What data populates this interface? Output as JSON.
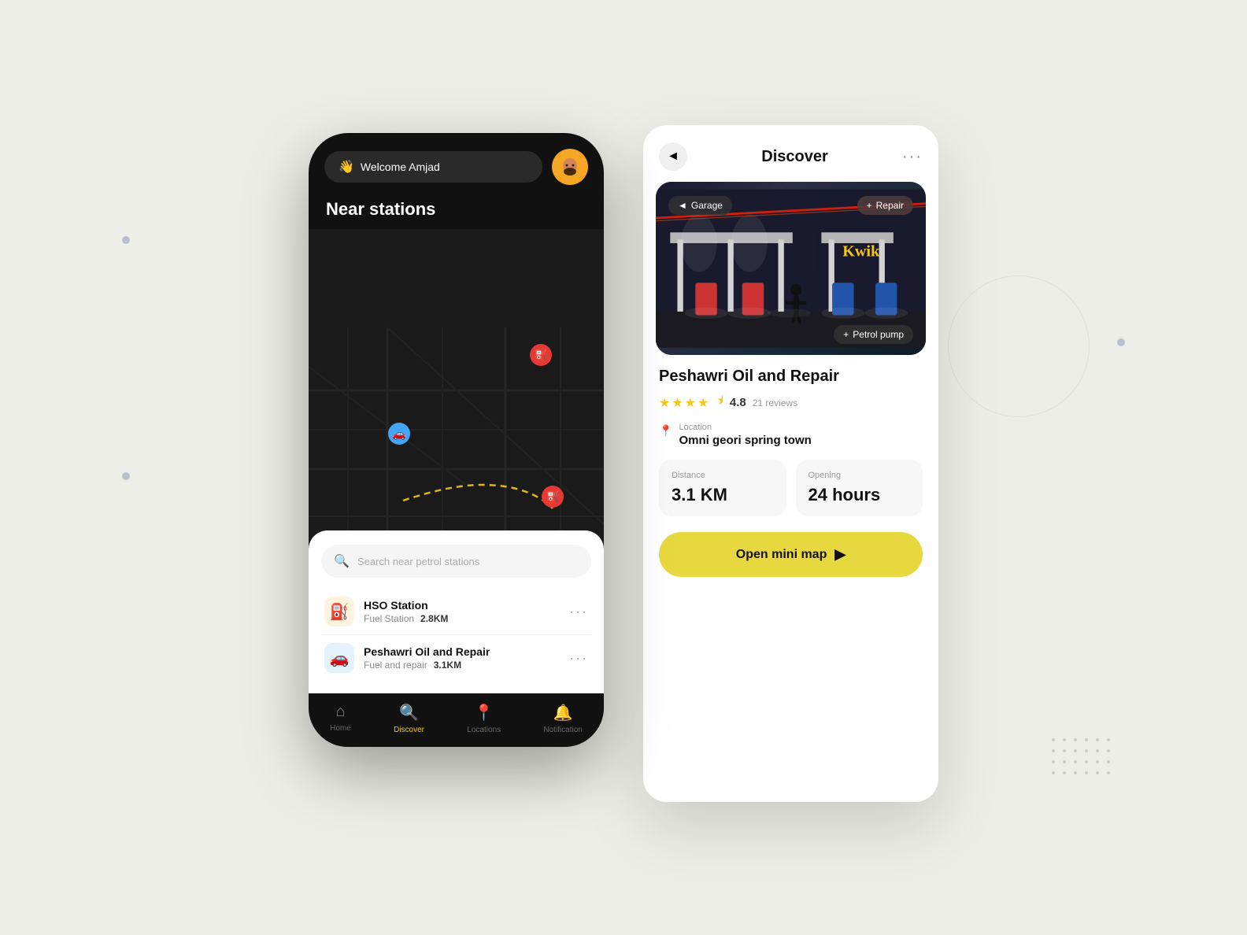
{
  "background": "#eeeee8",
  "left_phone": {
    "header": {
      "welcome_text": "Welcome Amjad",
      "wave_emoji": "👋"
    },
    "near_stations_title": "Near stations",
    "map": {
      "pins": [
        {
          "type": "red",
          "emoji": "📍"
        },
        {
          "type": "blue",
          "emoji": "🚗"
        },
        {
          "type": "red2",
          "emoji": "📍"
        }
      ]
    },
    "search": {
      "placeholder": "Search near petrol stations"
    },
    "stations": [
      {
        "name": "HSO Station",
        "type": "Fuel Station",
        "distance": "2.8KM",
        "icon": "⛽"
      },
      {
        "name": "Peshawri Oil and Repair",
        "type": "Fuel and repair",
        "distance": "3.1KM",
        "icon": "🚗"
      }
    ],
    "nav": [
      {
        "label": "Home",
        "icon": "⌂",
        "active": false
      },
      {
        "label": "Discover",
        "icon": "🔍",
        "active": true
      },
      {
        "label": "Locations",
        "icon": "📍",
        "active": false
      },
      {
        "label": "Notification",
        "icon": "🔔",
        "active": false
      }
    ]
  },
  "right_phone": {
    "header": {
      "title": "Discover",
      "back_icon": "◄",
      "more_icon": "···"
    },
    "hero": {
      "tags": [
        {
          "label": "Garage",
          "icon": "◄",
          "position": "top-left"
        },
        {
          "label": "Repair",
          "icon": "+",
          "position": "top-right"
        },
        {
          "label": "Petrol pump",
          "icon": "+",
          "position": "bottom-right"
        }
      ]
    },
    "station": {
      "name": "Peshawri Oil and Repair",
      "rating": "4.8",
      "review_count": "21 reviews",
      "stars_full": 4,
      "stars_half": 1,
      "location_label": "Location",
      "location_value": "Omni geori spring town",
      "distance_label": "Distance",
      "distance_value": "3.1 KM",
      "opening_label": "Opening",
      "opening_value": "24 hours"
    },
    "cta": {
      "label": "Open mini map",
      "icon": "▶"
    }
  }
}
